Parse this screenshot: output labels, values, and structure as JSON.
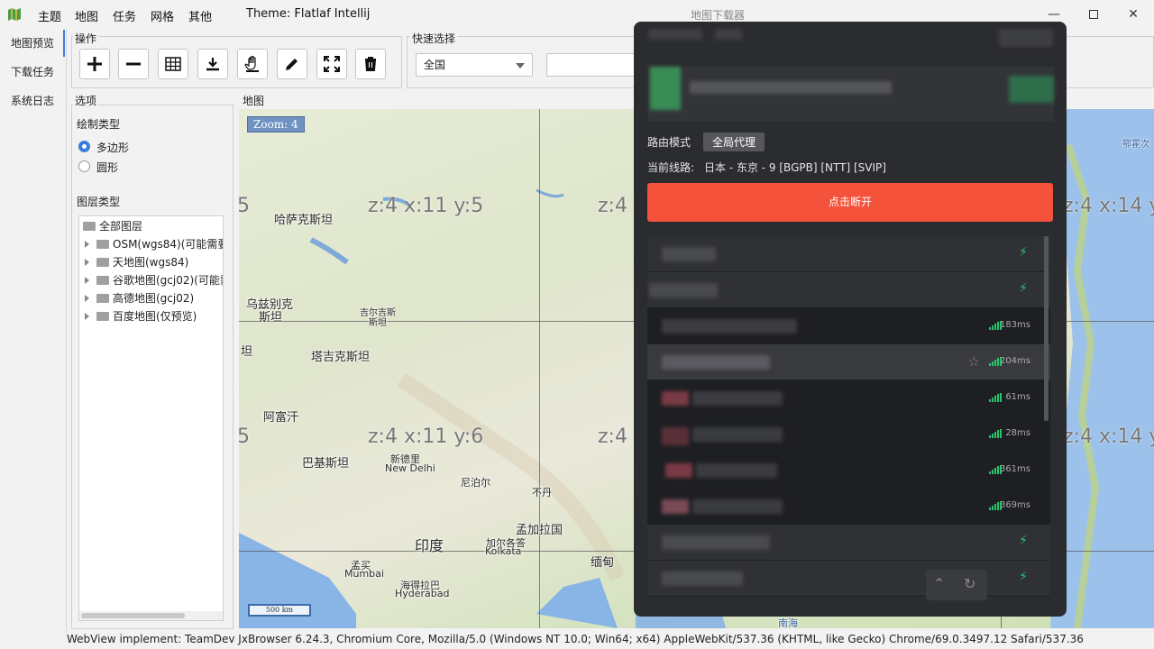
{
  "menu": [
    "主题",
    "地图",
    "任务",
    "网格",
    "其他"
  ],
  "theme_label": "Theme: Flatlaf Intellij",
  "window_title": "地图下载器",
  "nav": [
    "地图预览",
    "下载任务",
    "系统日志"
  ],
  "ops_title": "操作",
  "quick_title": "快速选择",
  "quick_select_value": "全国",
  "options_title": "选项",
  "draw_type_label": "绘制类型",
  "draw_types": [
    "多边形",
    "圆形"
  ],
  "layer_type_label": "图层类型",
  "tree": {
    "root": "全部图层",
    "items": [
      "OSM(wgs84)(可能需要",
      "天地图(wgs84)",
      "谷歌地图(gcj02)(可能需",
      "高德地图(gcj02)",
      "百度地图(仅预览)"
    ]
  },
  "map_title": "地图",
  "zoom_badge": "Zoom: 4",
  "scale_bar": "500 km",
  "tile_labels": [
    "z:4 x:11 y:5",
    "z:4",
    "z:4 x:14 y",
    "5",
    "z:4 x:11 y:6",
    "z:4",
    "z:4 x:14 y",
    "5"
  ],
  "place_labels": {
    "kazakhstan": "哈萨克斯坦",
    "uzbekistan": "乌兹别克",
    "uzbekistan2": "斯坦",
    "kyrgyzstan": "吉尔吉斯",
    "kyrgyzstan2": "斯坦",
    "tajikistan": "塔吉克斯坦",
    "tan": "坦",
    "afghanistan": "阿富汗",
    "pakistan": "巴基斯坦",
    "newdelhi_cn": "新德里",
    "newdelhi_en": "New Delhi",
    "nepal": "尼泊尔",
    "bhutan": "不丹",
    "bangladesh": "孟加拉国",
    "india": "印度",
    "kolkata_cn": "加尔各答",
    "kolkata_en": "Kolkata",
    "mumbai_cn": "孟买",
    "mumbai_en": "Mumbai",
    "hyderabad_cn": "海得拉巴",
    "hyderabad_en": "Hyderabad",
    "myanmar": "缅甸",
    "okhotsk": "鄂霍次",
    "southsea": "南海"
  },
  "vpn": {
    "route_mode_label": "路由模式",
    "route_mode_value": "全局代理",
    "current_line_label": "当前线路:",
    "current_line_value": "日本 - 东京 - 9 [BGPB] [NTT] [SVIP]",
    "disconnect_button": "点击断开",
    "latencies": [
      "183ms",
      "204ms",
      "61ms",
      "28ms",
      "361ms",
      "369ms"
    ]
  },
  "statusbar": "WebView implement:  TeamDev JxBrowser 6.24.3, Chromium Core, Mozilla/5.0 (Windows NT 10.0; Win64; x64) AppleWebKit/537.36 (KHTML, like Gecko) Chrome/69.0.3497.12 Safari/537.36",
  "colors": {
    "accent": "#3b7ddd",
    "vpn_button": "#f4523b",
    "vpn_bg": "#2b2c2f",
    "signal": "#27c26b"
  }
}
